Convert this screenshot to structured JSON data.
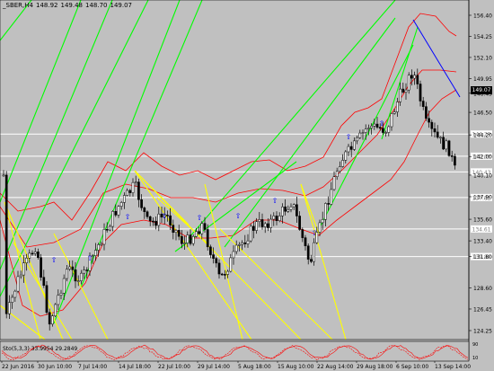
{
  "header": {
    "symbol": "_SBER,H4",
    "open": "148.92",
    "high": "149.48",
    "low": "148.70",
    "close": "149.07"
  },
  "price_axis": {
    "labels": [
      "156.40",
      "154.25",
      "152.10",
      "149.95",
      "148.45",
      "146.50",
      "144.20",
      "142.00",
      "140.10",
      "137.90",
      "135.60",
      "133.40",
      "131.80",
      "128.60",
      "126.45",
      "124.25"
    ],
    "current_price": "149.07",
    "level_tags": [
      "144.29",
      "142.03",
      "140.43",
      "137.82",
      "134.61",
      "131.80"
    ]
  },
  "sub_window": {
    "label": "Sto(5,3,3) 33.9954 29.2849",
    "axis_top": "90",
    "axis_bottom": "10"
  },
  "time_axis": {
    "labels": [
      "22 Jun 2016",
      "30 Jun 10:00",
      "7 Jul 14:00",
      "14 Jul 18:00",
      "22 Jul 10:00",
      "29 Jul 14:00",
      "5 Aug 18:00",
      "15 Aug 10:00",
      "22 Aug 14:00",
      "29 Aug 18:00",
      "6 Sep 10:00",
      "13 Sep 14:00"
    ]
  },
  "colors": {
    "background": "#c0c0c0",
    "bull_candle": "#000000",
    "bear_candle": "#000000",
    "bollinger": "#ff0000",
    "fan_lines_up": "#00ff00",
    "fan_lines_down": "#ffff00",
    "trend_line": "#0000ff",
    "level_lines": "#ffffff",
    "arrows": "#0000ff"
  }
}
